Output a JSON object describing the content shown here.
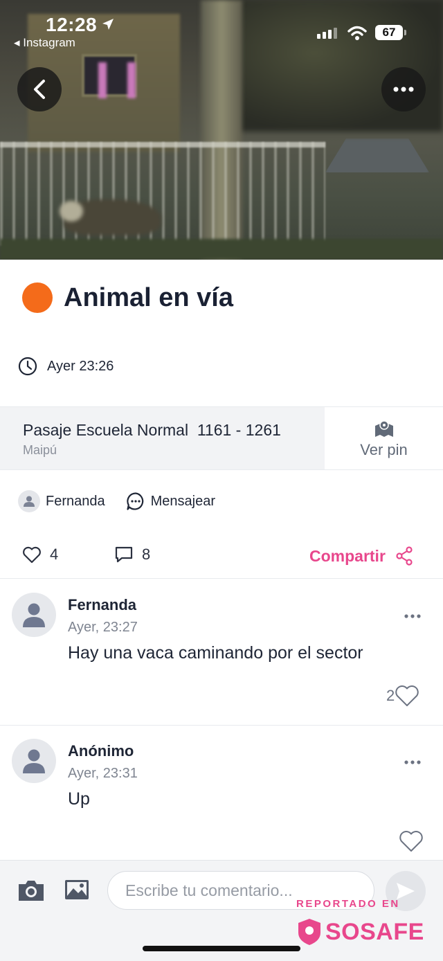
{
  "status_bar": {
    "time": "12:28",
    "back_app": "◂ Instagram",
    "battery": "67"
  },
  "report": {
    "title": "Animal en vía",
    "category_color": "#f46b1a",
    "time": "Ayer 23:26",
    "location": {
      "street": "Pasaje Escuela Normal  1161 - 1261",
      "commune": "Maipú",
      "pin_label": "Ver pin"
    },
    "author": "Fernanda",
    "message_label": "Mensajear",
    "likes": "4",
    "comments": "8",
    "share_label": "Compartir"
  },
  "comments": [
    {
      "name": "Fernanda",
      "time": "Ayer, 23:27",
      "text": "Hay una vaca caminando por el sector",
      "likes": "2"
    },
    {
      "name": "Anónimo",
      "time": "Ayer, 23:31",
      "text": "Up",
      "likes": ""
    }
  ],
  "composer": {
    "placeholder": "Escribe tu comentario..."
  },
  "watermark": {
    "reported": "REPORTADO EN",
    "brand": "SOSAFE",
    "color": "#e8478c"
  }
}
